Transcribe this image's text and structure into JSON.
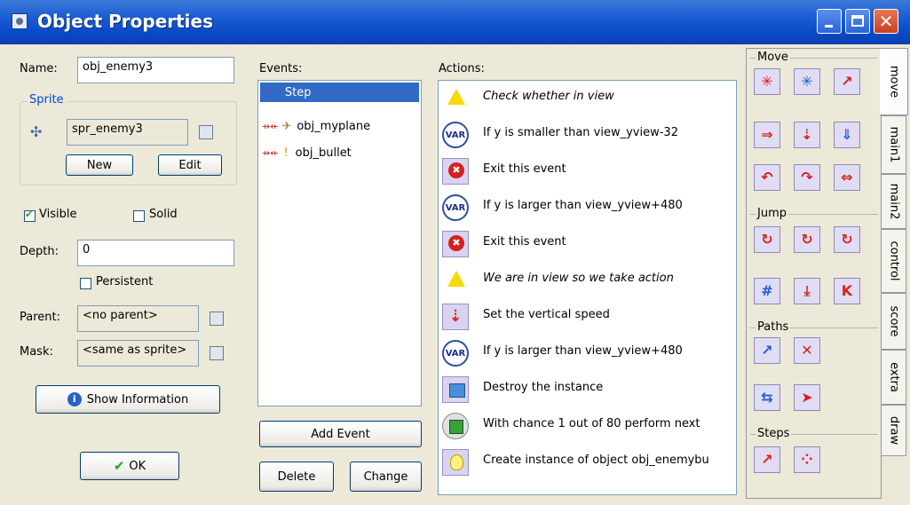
{
  "window": {
    "title": "Object Properties"
  },
  "name_label": "Name:",
  "name_value": "obj_enemy3",
  "sprite_group_label": "Sprite",
  "sprite_value": "spr_enemy3",
  "new_button": "New",
  "edit_button": "Edit",
  "visible_label": "Visible",
  "solid_label": "Solid",
  "depth_label": "Depth:",
  "depth_value": "0",
  "persistent_label": "Persistent",
  "parent_label": "Parent:",
  "parent_value": "<no parent>",
  "mask_label": "Mask:",
  "mask_value": "<same as sprite>",
  "show_info_button": "Show Information",
  "ok_button": "OK",
  "events_label": "Events:",
  "events": [
    {
      "label": "Step",
      "selected": true
    },
    {
      "label": "obj_myplane",
      "selected": false
    },
    {
      "label": "obj_bullet",
      "selected": false
    }
  ],
  "add_event_button": "Add Event",
  "delete_button": "Delete",
  "change_button": "Change",
  "actions_label": "Actions:",
  "actions": [
    {
      "icon": "warning-icon",
      "text": "Check whether in view",
      "italic": true
    },
    {
      "icon": "var-icon",
      "text": "If y is smaller than view_yview-32",
      "italic": false
    },
    {
      "icon": "exit-icon",
      "text": "Exit this event",
      "italic": false
    },
    {
      "icon": "var-icon",
      "text": "If y is larger than view_yview+480",
      "italic": false
    },
    {
      "icon": "exit-icon",
      "text": "Exit this event",
      "italic": false
    },
    {
      "icon": "warning-icon",
      "text": "We are in view so we take action",
      "italic": true
    },
    {
      "icon": "vspeed-icon",
      "text": "Set the vertical speed",
      "italic": false
    },
    {
      "icon": "var-icon",
      "text": "If y is larger than view_yview+480",
      "italic": false
    },
    {
      "icon": "destroy-icon",
      "text": "Destroy the instance",
      "italic": false
    },
    {
      "icon": "dice-icon",
      "text": "With chance 1 out of 80 perform next",
      "italic": false
    },
    {
      "icon": "bulb-icon",
      "text": "Create instance of object obj_enemybu",
      "italic": false
    }
  ],
  "panel": {
    "move_label": "Move",
    "jump_label": "Jump",
    "paths_label": "Paths",
    "steps_label": "Steps"
  },
  "tabs": [
    "move",
    "main1",
    "main2",
    "control",
    "score",
    "extra",
    "draw"
  ]
}
